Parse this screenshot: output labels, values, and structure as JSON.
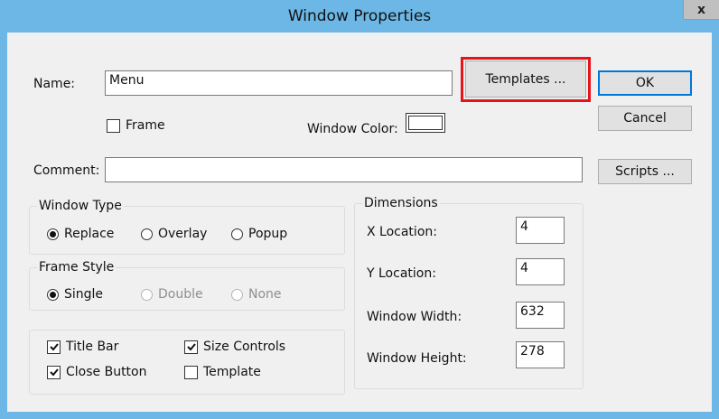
{
  "window": {
    "title": "Window Properties",
    "close_glyph": "x"
  },
  "name": {
    "label": "Name:",
    "value": "Menu"
  },
  "frame_checkbox": {
    "label": "Frame",
    "checked": false
  },
  "window_color": {
    "label": "Window Color:",
    "color": "#ffffff"
  },
  "comment": {
    "label": "Comment:",
    "value": ""
  },
  "buttons": {
    "templates": "Templates ...",
    "ok": "OK",
    "cancel": "Cancel",
    "scripts": "Scripts ..."
  },
  "window_type": {
    "title": "Window Type",
    "options": [
      "Replace",
      "Overlay",
      "Popup"
    ],
    "selected": "Replace"
  },
  "frame_style": {
    "title": "Frame Style",
    "options": [
      "Single",
      "Double",
      "None"
    ],
    "selected": "Single"
  },
  "flags": {
    "title_bar": {
      "label": "Title Bar",
      "checked": true
    },
    "size_controls": {
      "label": "Size Controls",
      "checked": true
    },
    "close_button": {
      "label": "Close Button",
      "checked": true
    },
    "template": {
      "label": "Template",
      "checked": false
    }
  },
  "dimensions": {
    "title": "Dimensions",
    "x_location": {
      "label": "X Location:",
      "value": "4"
    },
    "y_location": {
      "label": "Y Location:",
      "value": "4"
    },
    "window_width": {
      "label": "Window Width:",
      "value": "632"
    },
    "window_height": {
      "label": "Window Height:",
      "value": "278"
    }
  },
  "colors": {
    "highlight": "#e5141b",
    "titlebar": "#6cb7e6"
  }
}
